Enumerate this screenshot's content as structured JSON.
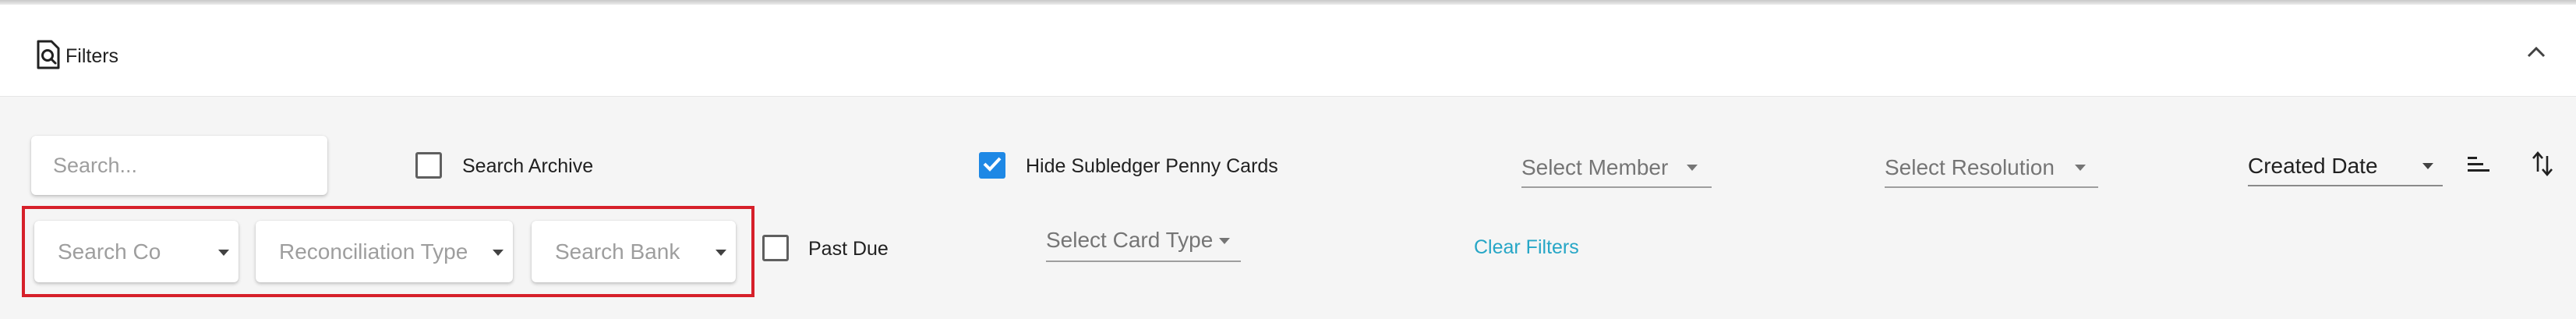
{
  "header": {
    "title": "Filters",
    "filters_icon": "document-search-icon",
    "collapse_icon": "chevron-up-icon"
  },
  "row1": {
    "search_placeholder": "Search...",
    "search_archive": {
      "label": "Search Archive",
      "checked": false
    },
    "hide_subledger": {
      "label": "Hide Subledger Penny Cards",
      "checked": true
    },
    "select_member": "Select Member",
    "select_resolution": "Select Resolution",
    "sort_by": "Created Date",
    "sort_lines_icon": "sort-lines-icon",
    "sort_direction_icon": "swap-vertical-icon"
  },
  "row2": {
    "search_co": "Search Co",
    "reconciliation_type": "Reconciliation Type",
    "search_bank": "Search Bank",
    "past_due": {
      "label": "Past Due",
      "checked": false
    },
    "select_card_type": "Select Card Type",
    "clear_filters": "Clear Filters"
  },
  "colors": {
    "accent_blue": "#1e88e5",
    "link_teal": "#26a6c6",
    "highlight_red": "#d6202a"
  }
}
